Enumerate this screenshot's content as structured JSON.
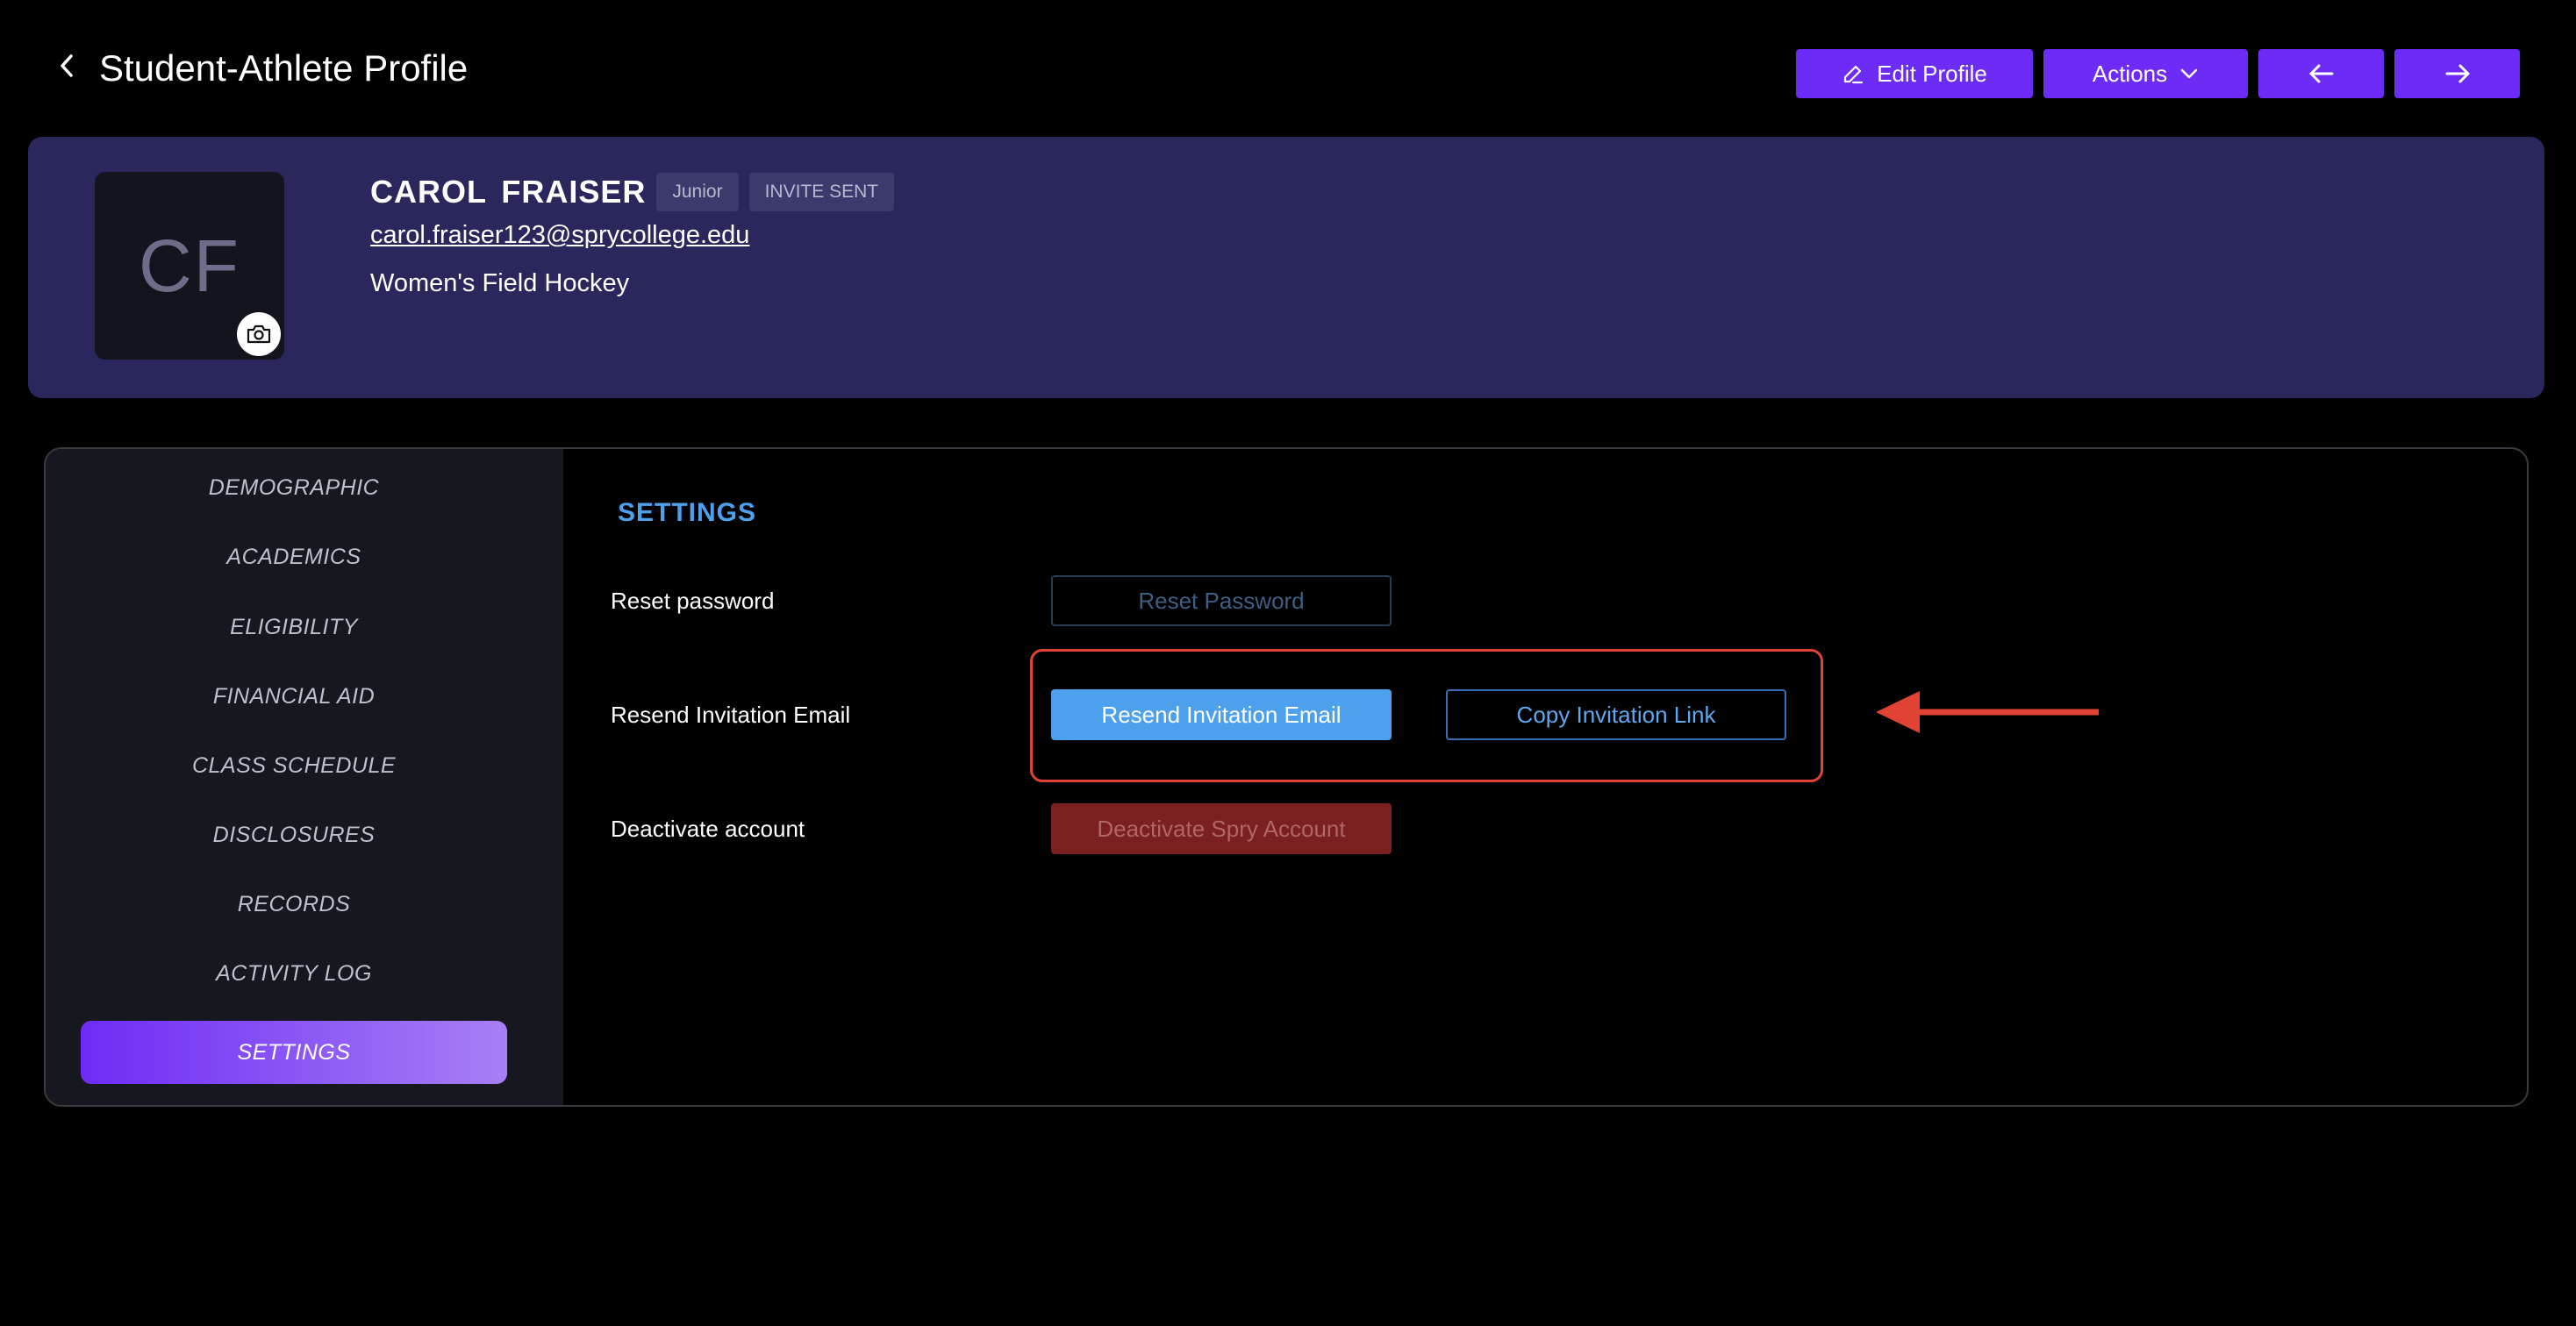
{
  "header": {
    "title": "Student-Athlete Profile",
    "edit_profile_label": "Edit Profile",
    "actions_label": "Actions"
  },
  "profile": {
    "initials": "CF",
    "name": "CAROL  FRAISER",
    "class_tag": "Junior",
    "status_tag": "INVITE SENT",
    "email": "carol.fraiser123@sprycollege.edu",
    "sport": "Women's Field Hockey"
  },
  "sidebar": {
    "items": [
      {
        "label": "DEMOGRAPHIC"
      },
      {
        "label": "ACADEMICS"
      },
      {
        "label": "ELIGIBILITY"
      },
      {
        "label": "FINANCIAL AID"
      },
      {
        "label": "CLASS SCHEDULE"
      },
      {
        "label": "DISCLOSURES"
      },
      {
        "label": "RECORDS"
      },
      {
        "label": "ACTIVITY LOG"
      },
      {
        "label": "SETTINGS",
        "active": true
      }
    ]
  },
  "settings": {
    "title": "SETTINGS",
    "reset_label": "Reset password",
    "reset_button": "Reset Password",
    "resend_label": "Resend Invitation Email",
    "resend_button": "Resend Invitation Email",
    "copy_link_button": "Copy Invitation Link",
    "deactivate_label": "Deactivate account",
    "deactivate_button": "Deactivate Spry Account"
  },
  "colors": {
    "accent": "#6d2cf5",
    "banner": "#29275b",
    "link_blue": "#4da1ec",
    "annotation_red": "#e04333",
    "danger": "#7a2020"
  },
  "icons": {
    "back": "chevron-left-icon",
    "edit": "pencil-icon",
    "actions": "chevron-down-icon",
    "prev": "arrow-left-icon",
    "next": "arrow-right-icon",
    "camera": "camera-icon"
  }
}
